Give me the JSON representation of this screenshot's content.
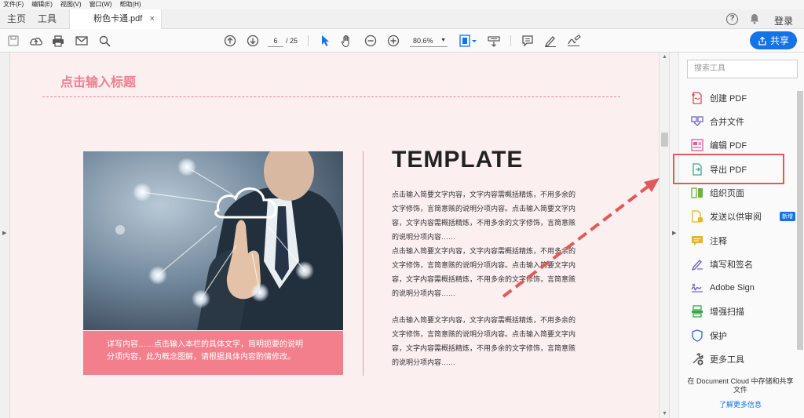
{
  "menu": [
    "文件(F)",
    "编辑(E)",
    "视图(V)",
    "窗口(W)",
    "帮助(H)"
  ],
  "tabs": {
    "home": "主页",
    "tools": "工具",
    "document": "粉色卡通.pdf",
    "close_glyph": "×"
  },
  "header": {
    "help_glyph": "?",
    "login": "登录"
  },
  "toolbar": {
    "page_current": "6",
    "page_total": "/ 25",
    "zoom": "80.6%",
    "share_label": "共享"
  },
  "document": {
    "title": "点击输入标题",
    "heading": "TEMPLATE",
    "caption_lines": [
      "详写内容……点击输入本栏的具体文字，简明扼要的说明",
      "分项内容，此为概念图解，请根据具体内容酌情修改。"
    ],
    "para1": [
      "点击输入简要文字内容，文字内容需概括精炼，不用多余的",
      "文字修饰，言简意赅的说明分项内容。点击输入简要文字内",
      "容，文字内容需概括精炼，不用多余的文字修饰，言简意赅",
      "的说明分项内容……",
      "点击输入简要文字内容，文字内容需概括精炼，不用多余的",
      "文字修饰，言简意赅的说明分项内容。点击输入简要文字内",
      "容，文字内容需概括精炼，不用多余的文字修饰，言简意赅",
      "的说明分项内容……"
    ],
    "para2": [
      "点击输入简要文字内容，文字内容需概括精炼，不用多余的",
      "文字修饰，言简意赅的说明分项内容。点击输入简要文字内",
      "容，文字内容需概括精炼，不用多余的文字修饰，言简意赅",
      "的说明分项内容……"
    ]
  },
  "tools_panel": {
    "search_placeholder": "搜索工具",
    "items": [
      {
        "label": "创建 PDF",
        "icon": "create-pdf-icon",
        "color": "#e34850"
      },
      {
        "label": "合并文件",
        "icon": "combine-files-icon",
        "color": "#7461c8"
      },
      {
        "label": "编辑 PDF",
        "icon": "edit-pdf-icon",
        "color": "#d95b9d"
      },
      {
        "label": "导出 PDF",
        "icon": "export-pdf-icon",
        "color": "#3aa88f"
      },
      {
        "label": "组织页面",
        "icon": "organize-pages-icon",
        "color": "#6cb33f"
      },
      {
        "label": "发送以供审阅",
        "icon": "send-review-icon",
        "color": "#e8b623",
        "badge": "新增"
      },
      {
        "label": "注释",
        "icon": "comment-icon",
        "color": "#e8b623"
      },
      {
        "label": "填写和签名",
        "icon": "fill-sign-icon",
        "color": "#7461c8"
      },
      {
        "label": "Adobe Sign",
        "icon": "adobe-sign-icon",
        "color": "#7461c8"
      },
      {
        "label": "增强扫描",
        "icon": "enhance-scan-icon",
        "color": "#3aa84a"
      },
      {
        "label": "保护",
        "icon": "protect-icon",
        "color": "#4a6cd4"
      },
      {
        "label": "更多工具",
        "icon": "more-tools-icon",
        "color": "#555555"
      }
    ],
    "cloud_text_1": "在 Document Cloud 中存储和共享",
    "cloud_text_2": "文件",
    "learn_more": "了解更多信息"
  },
  "colors": {
    "accent": "#1473e6",
    "doc_bg": "#fcefef",
    "pink": "#f37f8d",
    "highlight": "#e15a5a"
  }
}
